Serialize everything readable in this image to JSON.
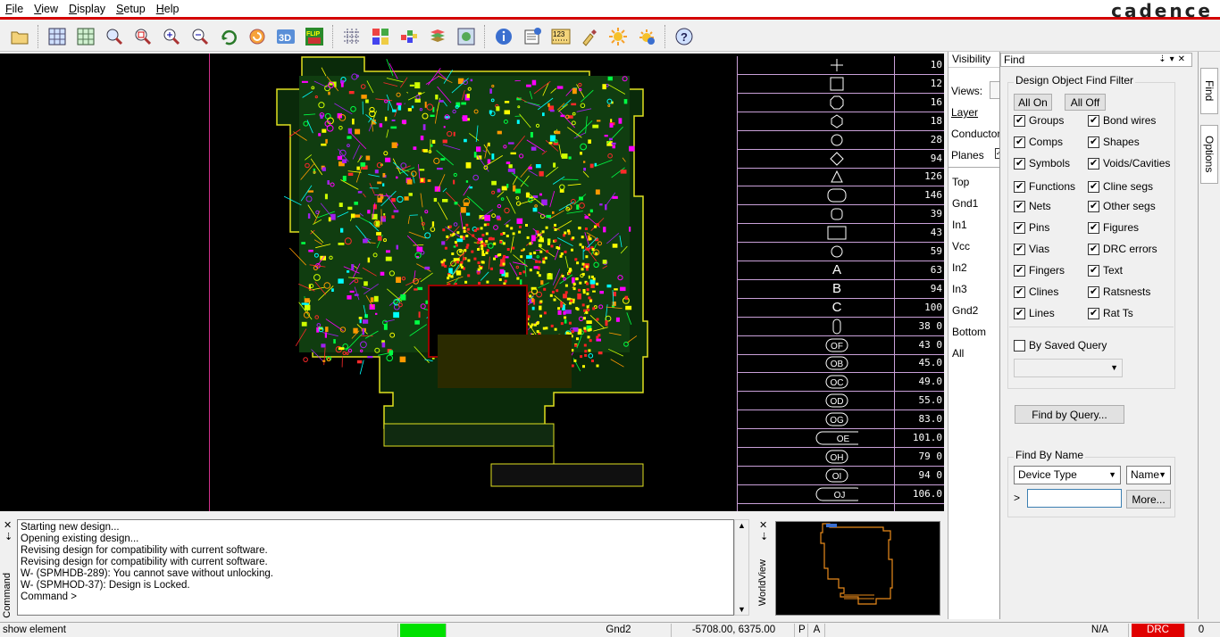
{
  "menu": {
    "items": [
      "File",
      "View",
      "Display",
      "Setup",
      "Help"
    ],
    "brand": "cadence"
  },
  "toolbar": {
    "icons": [
      "open-folder",
      "grid-zoom",
      "grid-zoom-2",
      "zoom-fit",
      "zoom-window",
      "zoom-in",
      "zoom-out",
      "zoom-previous",
      "redraw",
      "3d-view",
      "flip",
      "grid",
      "layout-panels",
      "color-palette",
      "layers",
      "world-view",
      "info",
      "properties",
      "measure-123",
      "highlight-brush",
      "shadow-mode",
      "dim-mode",
      "help"
    ],
    "flip_label": "FLIP",
    "three_d_label": "3D",
    "measure_label": "123"
  },
  "padstack_table": {
    "rows": [
      {
        "shape": "+",
        "value": "10"
      },
      {
        "shape": "square",
        "value": "12"
      },
      {
        "shape": "octagon",
        "value": "16"
      },
      {
        "shape": "hexagon",
        "value": "18"
      },
      {
        "shape": "circle",
        "value": "28"
      },
      {
        "shape": "diamond",
        "value": "94"
      },
      {
        "shape": "triangle",
        "value": "126"
      },
      {
        "shape": "rounded",
        "value": "146"
      },
      {
        "shape": "rounded-small",
        "value": "39"
      },
      {
        "shape": "rectangle",
        "value": "43"
      },
      {
        "shape": "circle",
        "value": "59"
      },
      {
        "shape": "A",
        "value": "63"
      },
      {
        "shape": "B",
        "value": "94"
      },
      {
        "shape": "C",
        "value": "100"
      },
      {
        "shape": "obround-v",
        "value": "38 0"
      },
      {
        "shape": "OF",
        "value": "43 0"
      },
      {
        "shape": "OB",
        "value": "45.0"
      },
      {
        "shape": "OC",
        "value": "49.0"
      },
      {
        "shape": "OD",
        "value": "55.0"
      },
      {
        "shape": "OG",
        "value": "83.0"
      },
      {
        "shape": "OE",
        "value": "101.0"
      },
      {
        "shape": "OH",
        "value": "79 0"
      },
      {
        "shape": "OI",
        "value": "94 0"
      },
      {
        "shape": "OJ",
        "value": "106.0"
      }
    ]
  },
  "visibility": {
    "title": "Visibility",
    "views_label": "Views:",
    "layer_label": "Layer",
    "conductors_label": "Conductors",
    "planes_label": "Planes",
    "layers": [
      "Top",
      "Gnd1",
      "In1",
      "Vcc",
      "In2",
      "In3",
      "Gnd2",
      "Bottom",
      "All"
    ]
  },
  "find": {
    "title": "Find",
    "filter_label": "Design Object Find Filter",
    "all_on": "All On",
    "all_off": "All Off",
    "left_checks": [
      {
        "label": "Groups",
        "checked": true
      },
      {
        "label": "Comps",
        "checked": true
      },
      {
        "label": "Symbols",
        "checked": true
      },
      {
        "label": "Functions",
        "checked": true
      },
      {
        "label": "Nets",
        "checked": true
      },
      {
        "label": "Pins",
        "checked": true
      },
      {
        "label": "Vias",
        "checked": true
      },
      {
        "label": "Fingers",
        "checked": true
      },
      {
        "label": "Clines",
        "checked": true
      },
      {
        "label": "Lines",
        "checked": true
      }
    ],
    "right_checks": [
      {
        "label": "Bond wires",
        "checked": true
      },
      {
        "label": "Shapes",
        "checked": true
      },
      {
        "label": "Voids/Cavities",
        "checked": true
      },
      {
        "label": "Cline segs",
        "checked": true
      },
      {
        "label": "Other segs",
        "checked": true
      },
      {
        "label": "Figures",
        "checked": true
      },
      {
        "label": "DRC errors",
        "checked": true
      },
      {
        "label": "Text",
        "checked": true
      },
      {
        "label": "Ratsnests",
        "checked": true
      },
      {
        "label": "Rat Ts",
        "checked": true
      }
    ],
    "by_saved_query": "By Saved Query",
    "find_by_query": "Find by Query...",
    "find_by_name_label": "Find By Name",
    "device_type": "Device Type",
    "name_option": "Name",
    "more_button": "More...",
    "prompt": ">"
  },
  "side_tabs": [
    "Find",
    "Options"
  ],
  "command": {
    "side_label": "Command",
    "lines": [
      "Starting new design...",
      "Opening existing design...",
      "Revising design for compatibility with current software.",
      "Revising design for compatibility with current software.",
      "W- (SPMHDB-289): You cannot save without unlocking.",
      "W- (SPMHOD-37): Design is Locked.",
      "Command >"
    ]
  },
  "worldview": {
    "side_label": "WorldView"
  },
  "statusbar": {
    "message": "show element",
    "active_layer": "Gnd2",
    "coordinates": "-5708.00, 6375.00",
    "p_flag": "P",
    "a_flag": "A",
    "na": "N/A",
    "drc_label": "DRC",
    "drc_count": "0",
    "colors": {
      "idle": "#00e000",
      "drc": "#e00000"
    }
  }
}
